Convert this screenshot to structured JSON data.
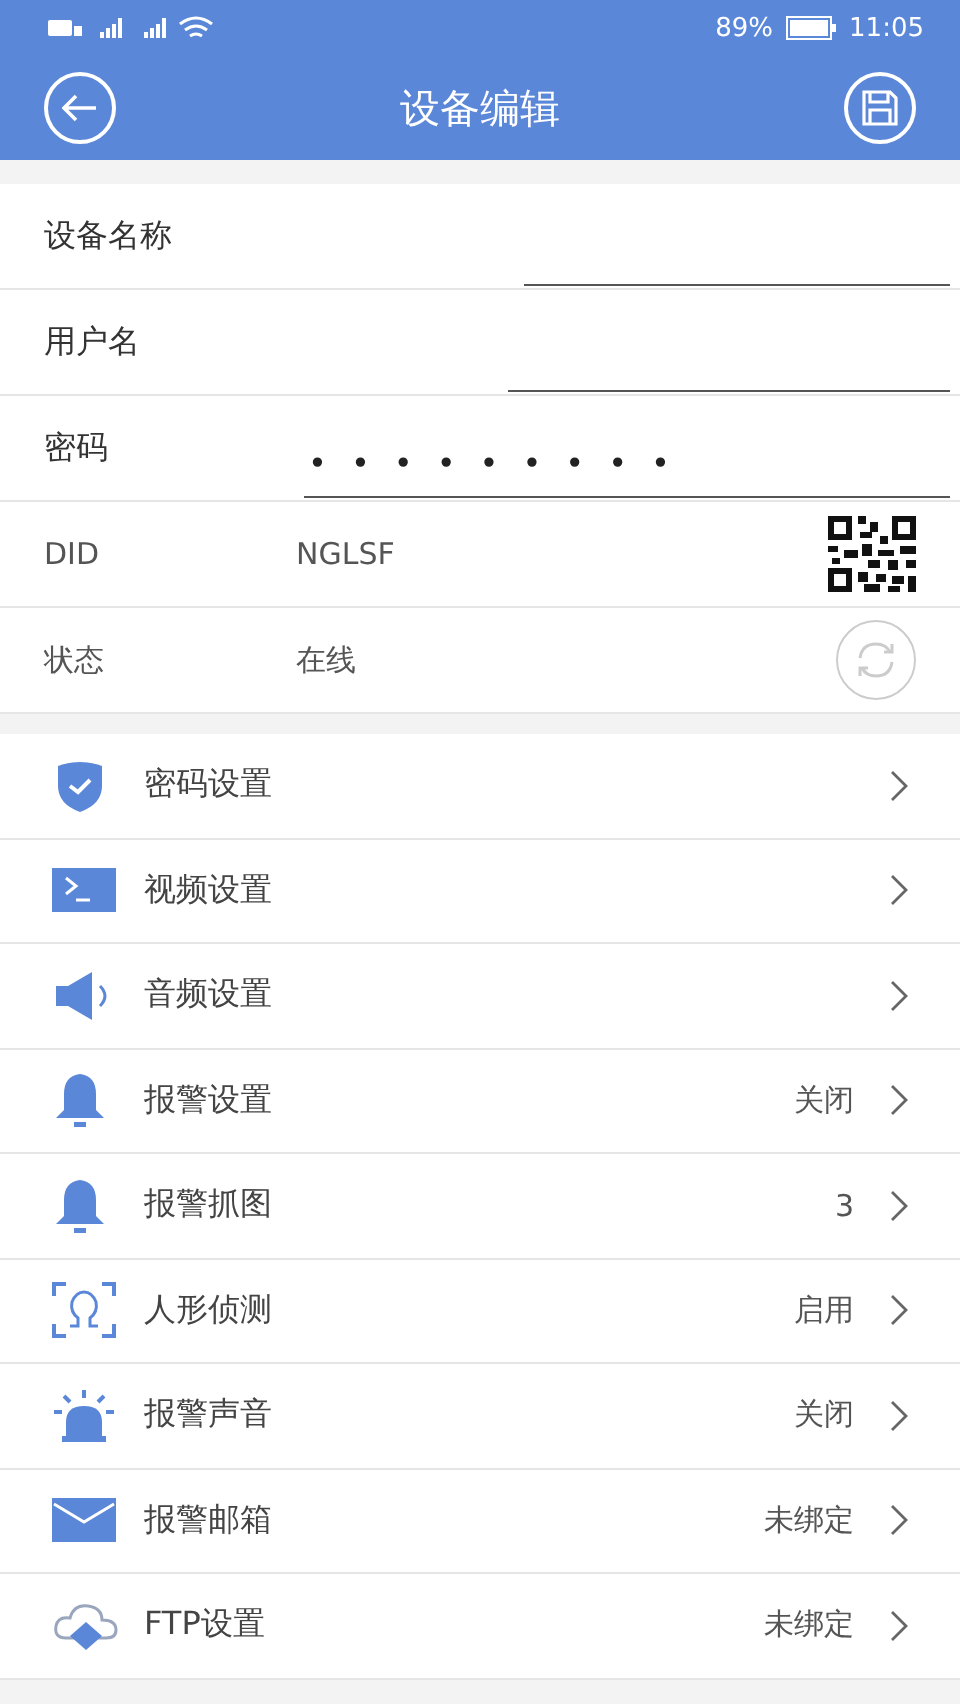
{
  "status_bar": {
    "battery": "89%",
    "time": "11:05"
  },
  "header": {
    "title": "设备编辑"
  },
  "form": {
    "fields": [
      {
        "label": "设备名称"
      },
      {
        "label": "用户名"
      },
      {
        "label": "密码",
        "value": "•••••••••"
      }
    ],
    "did": {
      "label": "DID",
      "value": "NGLSF"
    },
    "status": {
      "label": "状态",
      "value": "在线"
    }
  },
  "menu": [
    {
      "label": "密码设置"
    },
    {
      "label": "视频设置"
    },
    {
      "label": "音频设置"
    },
    {
      "label": "报警设置",
      "value": "关闭"
    },
    {
      "label": "报警抓图",
      "value": "3"
    },
    {
      "label": "人形侦测",
      "value": "启用"
    },
    {
      "label": "报警声音",
      "value": "关闭"
    },
    {
      "label": "报警邮箱",
      "value": "未绑定"
    },
    {
      "label": "FTP设置",
      "value": "未绑定"
    }
  ]
}
